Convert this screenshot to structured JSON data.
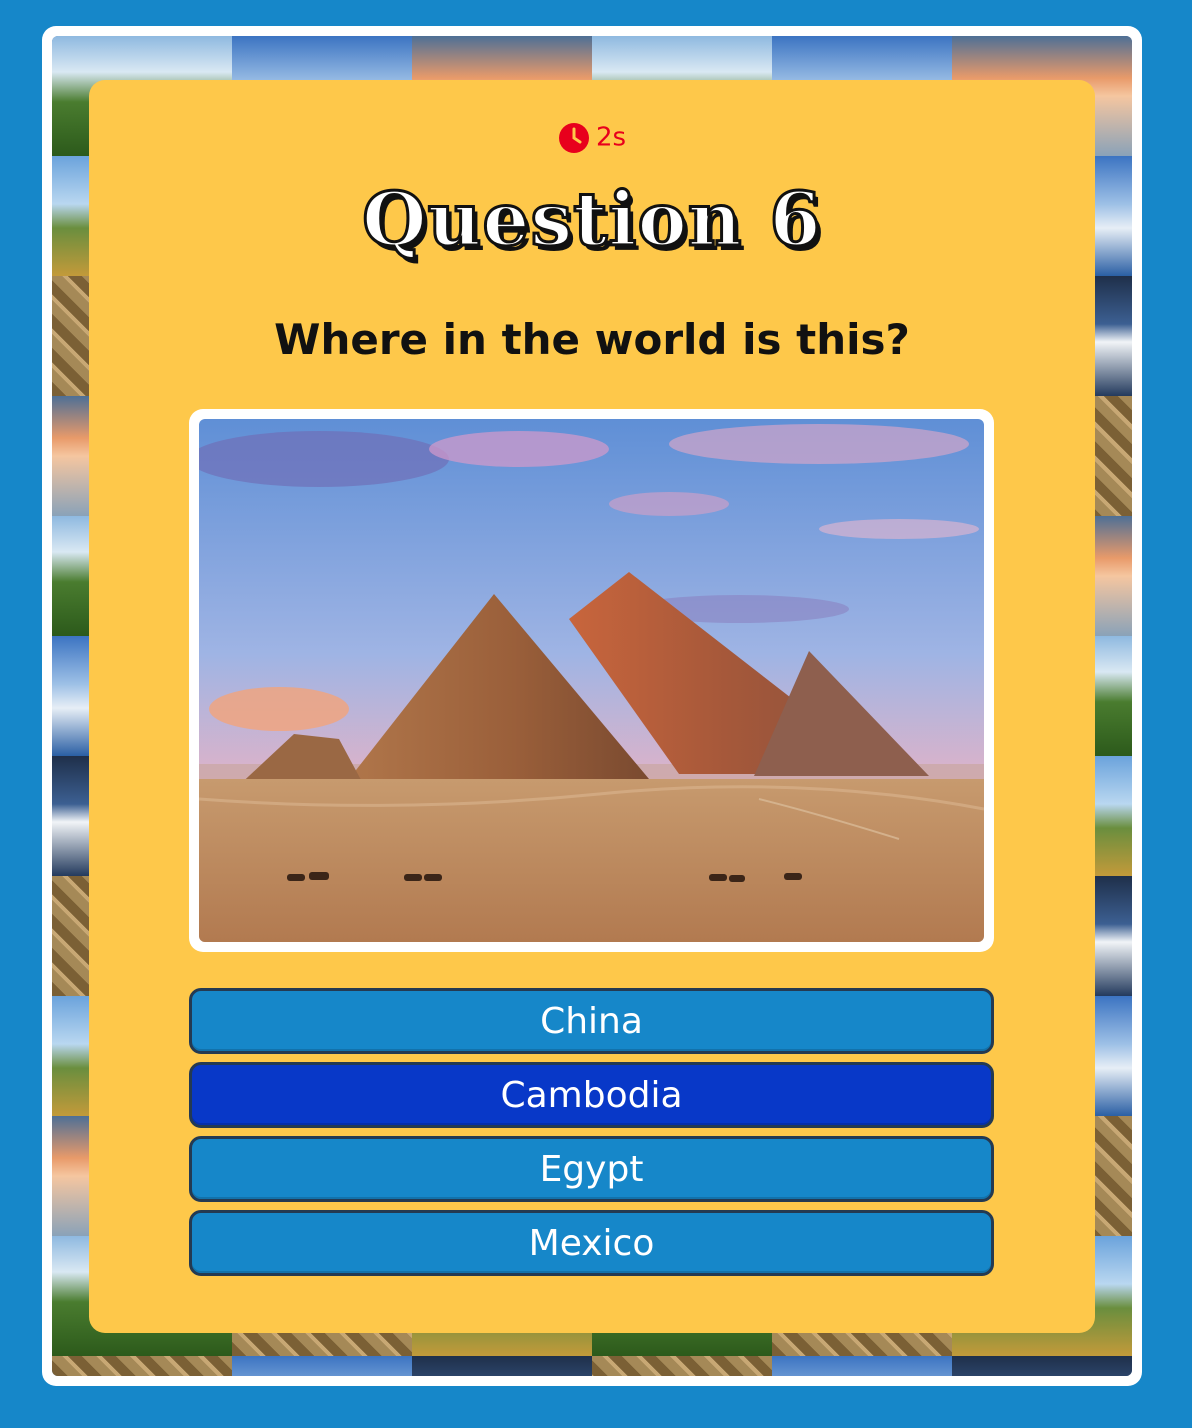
{
  "timer": {
    "icon": "clock-icon",
    "value": "2s",
    "color": "#e8001c"
  },
  "question": {
    "title": "Question 6",
    "prompt": "Where in the world is this?"
  },
  "image": {
    "subject": "pyramids-photo"
  },
  "answers": [
    {
      "label": "China",
      "selected": false
    },
    {
      "label": "Cambodia",
      "selected": true
    },
    {
      "label": "Egypt",
      "selected": false
    },
    {
      "label": "Mexico",
      "selected": false
    }
  ],
  "colors": {
    "page_background": "#1687c9",
    "card_background": "#fec84a",
    "answer_default": "#1687c9",
    "answer_selected": "#0838c8"
  }
}
